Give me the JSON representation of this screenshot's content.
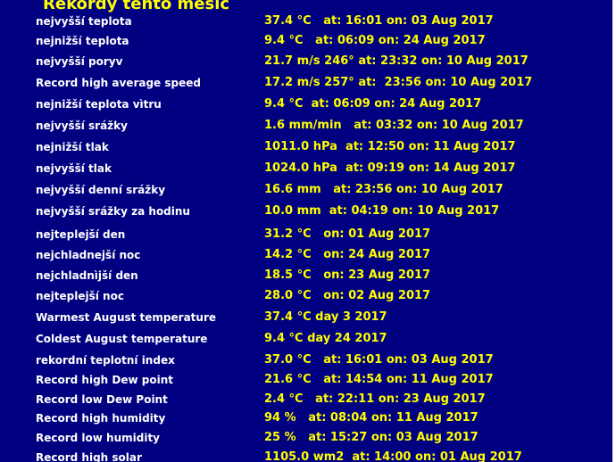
{
  "title": "Rekordy tento měsíc",
  "colors": {
    "background": "#000080",
    "label": "#ffffff",
    "value": "#ffff00",
    "title": "#ffff00"
  },
  "records": [
    {
      "label": "nejvyšší teplota",
      "value": "37.4 °C   at: 16:01 on: 03 Aug 2017"
    },
    {
      "label": "nejnižší teplota",
      "value": "9.4 °C   at: 06:09 on: 24 Aug 2017"
    },
    {
      "label": "nejvyšší poryv",
      "value": "21.7 m/s 246° at: 23:32 on: 10 Aug 2017"
    },
    {
      "label": "Record high average speed",
      "value": "17.2 m/s 257° at:  23:56 on: 10 Aug 2017"
    },
    {
      "label": "nejnižší teplota vìtru",
      "value": "9.4 °C  at: 06:09 on: 24 Aug 2017"
    },
    {
      "label": "nejvyšší srážky",
      "value": "1.6 mm/min   at: 03:32 on: 10 Aug 2017"
    },
    {
      "label": "nejnižší tlak",
      "value": "1011.0 hPa  at: 12:50 on: 11 Aug 2017"
    },
    {
      "label": "nejvyšší tlak",
      "value": "1024.0 hPa  at: 09:19 on: 14 Aug 2017"
    },
    {
      "label": "nejvyšší denní srážky",
      "value": "16.6 mm   at: 23:56 on: 10 Aug 2017"
    },
    {
      "label": "nejvyšší srážky za hodinu",
      "value": "10.0 mm  at: 04:19 on: 10 Aug 2017"
    },
    {
      "label": "nejteplejší den",
      "value": "31.2 °C   on: 01 Aug 2017"
    },
    {
      "label": "nejchladnejší noc",
      "value": "14.2 °C   on: 24 Aug 2017"
    },
    {
      "label": "nejchladnìjší den",
      "value": "18.5 °C   on: 23 Aug 2017"
    },
    {
      "label": "nejteplejší noc",
      "value": "28.0 °C   on: 02 Aug 2017"
    },
    {
      "label": "Warmest August temperature",
      "value": "37.4 °C day 3 2017"
    },
    {
      "label": "Coldest August temperature",
      "value": "9.4 °C day 24 2017"
    },
    {
      "label": "rekordní teplotní index",
      "value": "37.0 °C   at: 16:01 on: 03 Aug 2017"
    },
    {
      "label": "Record high Dew point",
      "value": "21.6 °C   at: 14:54 on: 11 Aug 2017"
    },
    {
      "label": "Record low Dew Point",
      "value": "2.4 °C   at: 22:11 on: 23 Aug 2017"
    },
    {
      "label": "Record high humidity",
      "value": "94 %   at: 08:04 on: 11 Aug 2017"
    },
    {
      "label": "Record low humidity",
      "value": "25 %   at: 15:27 on: 03 Aug 2017"
    },
    {
      "label": "Record high solar",
      "value": "1105.0 wm2  at: 14:00 on: 01 Aug 2017"
    }
  ]
}
